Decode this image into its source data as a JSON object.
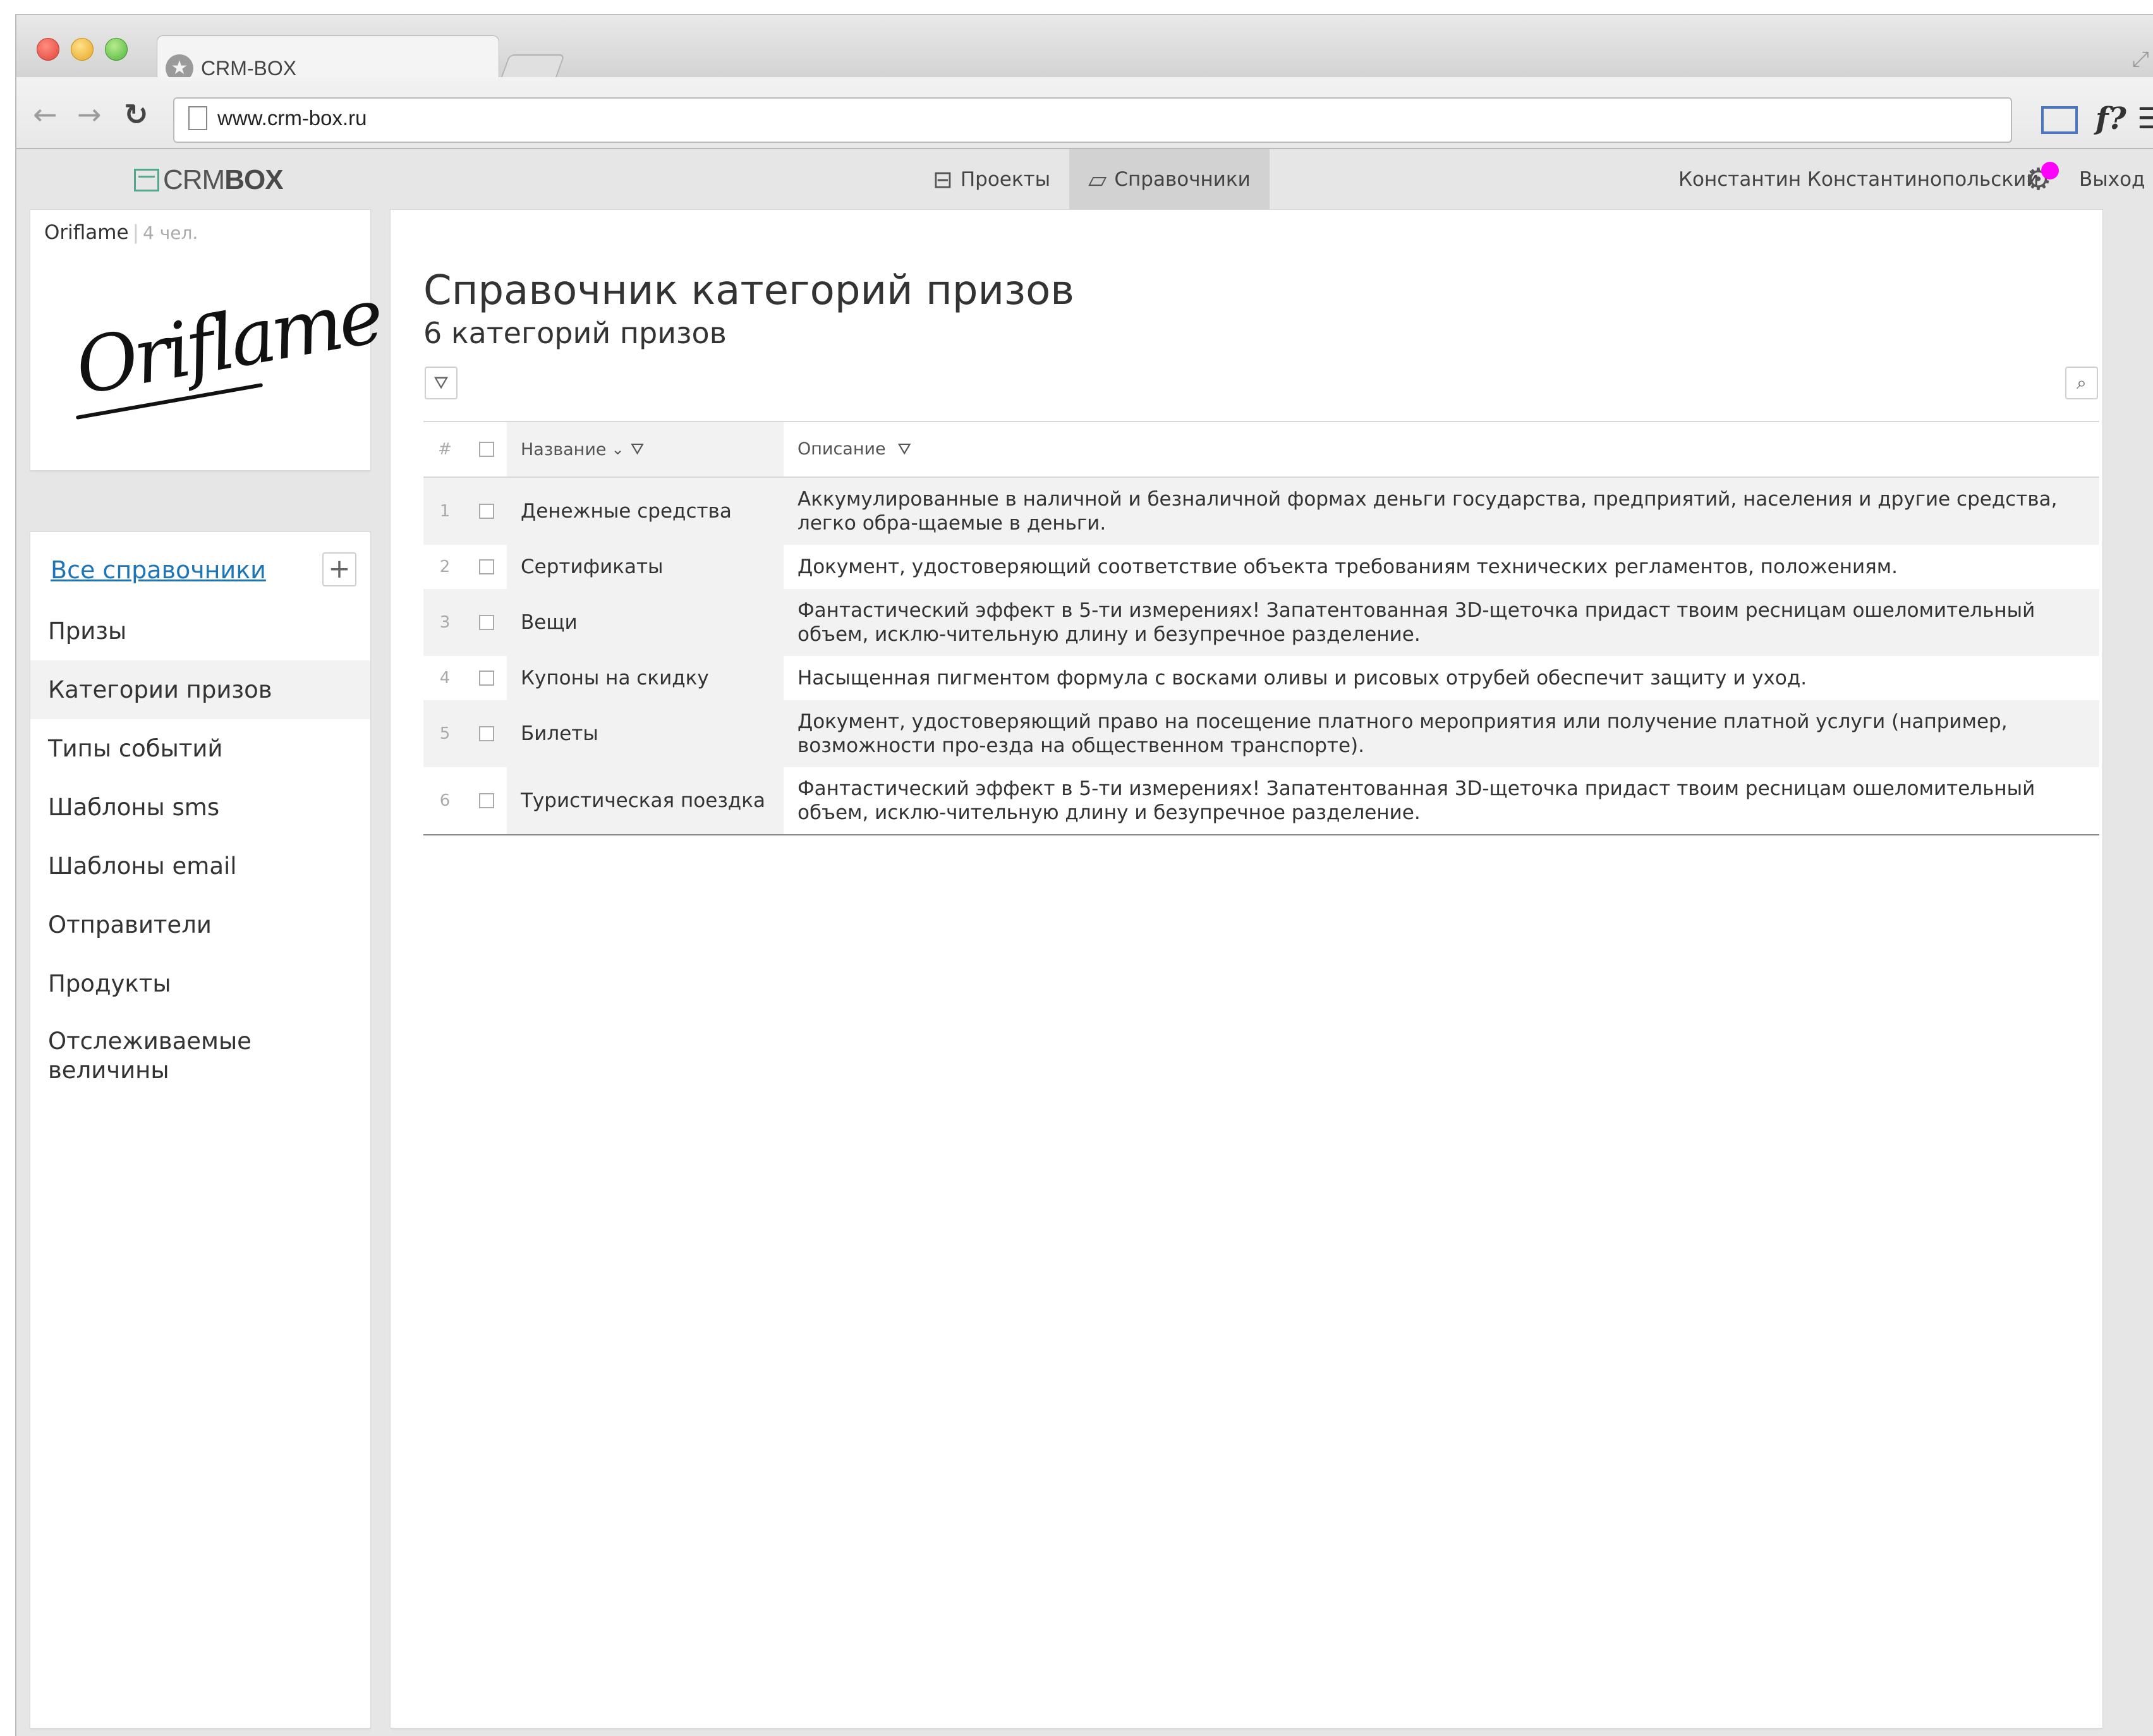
{
  "browser": {
    "tab_title": "CRM-BOX",
    "url": "www.crm-box.ru",
    "icons": [
      "back-arrow-icon",
      "forward-arrow-icon",
      "reload-icon",
      "page-icon",
      "cast-icon",
      "font-icon",
      "menu-icon"
    ],
    "fq_label": "f?"
  },
  "app": {
    "logo": {
      "part1": "CRM",
      "part2": "BOX"
    },
    "nav": [
      {
        "label": "Проекты",
        "icon": "archive-icon",
        "active": false
      },
      {
        "label": "Справочники",
        "icon": "book-icon",
        "active": true
      }
    ],
    "user_name": "Константин Константинопольский",
    "logout_label": "Выход",
    "notification_color": "#ff00ff"
  },
  "org": {
    "name": "Oriflame",
    "members": "4 чел.",
    "logo_text": "Oriflame"
  },
  "sidebar": {
    "all_label": "Все справочники",
    "add_label": "+",
    "items": [
      {
        "label": "Призы",
        "active": false
      },
      {
        "label": "Категории призов",
        "active": true
      },
      {
        "label": "Типы событий",
        "active": false
      },
      {
        "label": "Шаблоны sms",
        "active": false
      },
      {
        "label": "Шаблоны email",
        "active": false
      },
      {
        "label": "Отправители",
        "active": false
      },
      {
        "label": "Продукты",
        "active": false
      },
      {
        "label": "Отслеживаемые величины",
        "active": false
      }
    ]
  },
  "main": {
    "title": "Справочник категорий призов",
    "count_label": "6 категорий призов",
    "table": {
      "headers": {
        "num": "#",
        "name": "Название",
        "description": "Описание"
      },
      "rows": [
        {
          "num": "1",
          "name": "Денежные средства",
          "description": "Аккумулированные в наличной и безналичной формах деньги государства, предприятий, населения и другие средства, легко обра-щаемые в деньги."
        },
        {
          "num": "2",
          "name": "Сертификаты",
          "description": "Документ, удостоверяющий соответствие объекта требованиям технических регламентов, положениям."
        },
        {
          "num": "3",
          "name": "Вещи",
          "description": "Фантастический эффект в 5-ти измерениях! Запатентованная 3D-щеточка придаст твоим ресницам ошеломительный объем, исклю-чительную длину и безупречное разделение."
        },
        {
          "num": "4",
          "name": "Купоны на скидку",
          "description": "Насыщенная пигментом формула с восками оливы и рисовых отрубей обеспечит защиту и уход."
        },
        {
          "num": "5",
          "name": "Билеты",
          "description": "Документ, удостоверяющий право на посещение платного мероприятия или получение платной услуги (например, возможности про-езда на общественном транспорте)."
        },
        {
          "num": "6",
          "name": "Туристическая поездка",
          "description": "Фантастический эффект в 5-ти измерениях! Запатентованная 3D-щеточка придаст твоим ресницам ошеломительный объем, исклю-чительную длину и безупречное разделение."
        }
      ]
    }
  }
}
